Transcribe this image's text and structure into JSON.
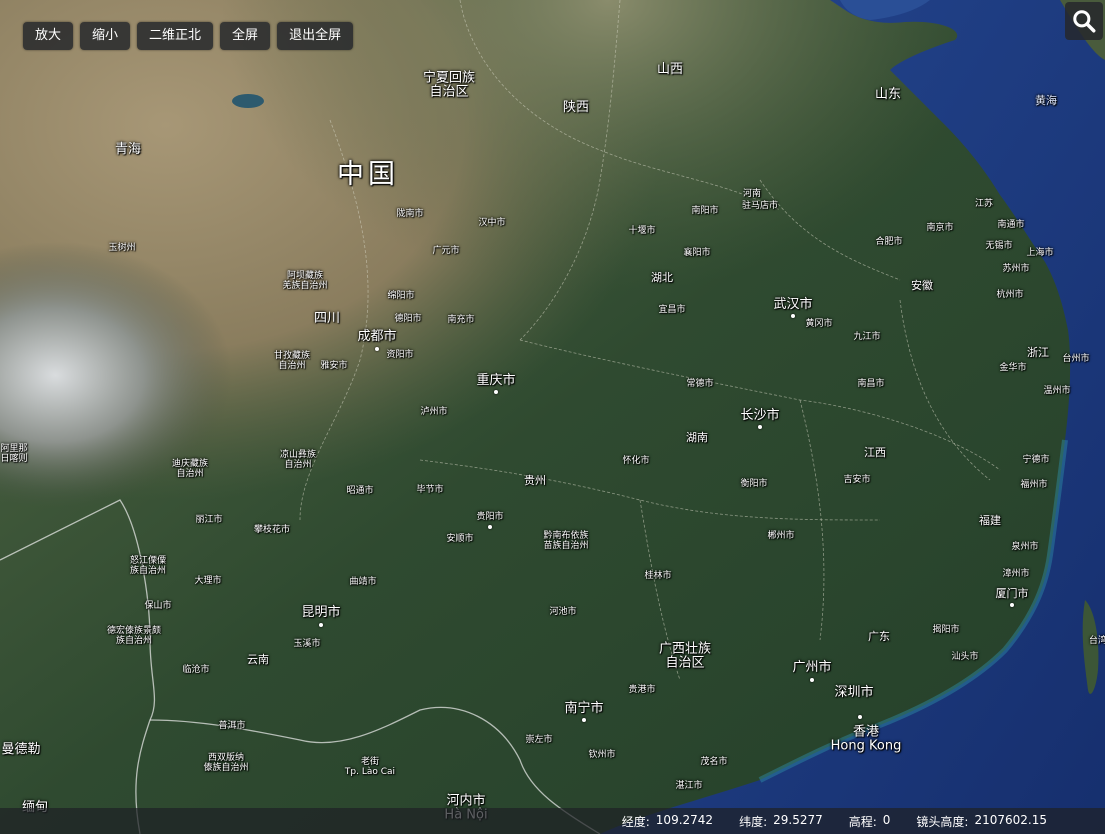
{
  "toolbar": {
    "zoom_in": "放大",
    "zoom_out": "缩小",
    "north_2d": "二维正北",
    "fullscreen": "全屏",
    "exit_fullscreen": "退出全屏"
  },
  "search": {
    "icon": "search-icon"
  },
  "map": {
    "style": "satellite-imagery",
    "colors": {
      "sea": "#1f3f86",
      "land_green": "#2e4a2f",
      "plateau": "#8f7f5e",
      "snow": "#e8ecef"
    },
    "labels": {
      "china": "中国",
      "qinghai": "青海",
      "ningxia": "宁夏回族\n自治区",
      "shaanxi": "陕西",
      "shanxi": "山西",
      "shandong": "山东",
      "yellow_sea": "黄海",
      "henan": "河南",
      "zhumadian": "驻马店市",
      "nanyang": "南阳市",
      "longnan": "陇南市",
      "hanzhong": "汉中市",
      "shiyan": "十堰市",
      "xiangyang": "襄阳市",
      "guangyuan": "广元市",
      "jiangsu": "江苏",
      "nanjing": "南京市",
      "nantong": "南通市",
      "hefei": "合肥市",
      "wuxi": "无锡市",
      "shanghai": "上海市",
      "suzhou": "苏州市",
      "yushu": "玉树州",
      "aba": "阿坝藏族\n羌族自治州",
      "mianyang": "绵阳市",
      "deyang": "德阳市",
      "nanchong": "南充市",
      "sichuan": "四川",
      "chengdu": "成都市",
      "ziyang": "资阳市",
      "hubei": "湖北",
      "yichang": "宜昌市",
      "wuhan": "武汉市",
      "huanggang": "黄冈市",
      "anhui": "安徽",
      "hangzhou": "杭州市",
      "jiujiang": "九江市",
      "ganzi": "甘孜藏族\n自治州",
      "yaan": "雅安市",
      "chongqing": "重庆市",
      "changde": "常德市",
      "zhejiang": "浙江",
      "jinhua": "金华市",
      "taizhou": "台州市",
      "wenzhou": "温州市",
      "nanchang": "南昌市",
      "luzhou": "泸州市",
      "changsha": "长沙市",
      "hunan": "湖南",
      "nagqu": "阿里那\n日喀则",
      "liangshan": "凉山彝族\n自治州",
      "diqing": "迪庆藏族\n自治州",
      "zhaotong": "昭通市",
      "bijie": "毕节市",
      "guizhou": "贵州",
      "huaihua": "怀化市",
      "jiangxi": "江西",
      "hengyang": "衡阳市",
      "jian": "吉安市",
      "ningde": "宁德市",
      "fuzhou": "福州市",
      "lijiang": "丽江市",
      "panzhihua": "攀枝花市",
      "guiyang": "贵阳市",
      "anshun": "安顺市",
      "qiannan": "黔南布依族\n苗族自治州",
      "chenzhou": "郴州市",
      "fujian": "福建",
      "quanzhou": "泉州市",
      "nujiang": "怒江傈僳\n族自治州",
      "dali": "大理市",
      "qujing": "曲靖市",
      "guilin": "桂林市",
      "zhangzhou": "漳州市",
      "xiamen": "厦门市",
      "baoshan": "保山市",
      "dehong": "德宏傣族景颇\n族自治州",
      "kunming": "昆明市",
      "yuxi": "玉溪市",
      "hechi": "河池市",
      "guangdong": "广东",
      "jieyang": "揭阳市",
      "shantou": "汕头市",
      "lincang": "临沧市",
      "yunnan": "云南",
      "guangxi": "广西壮族\n自治区",
      "guangzhou": "广州市",
      "shenzhen": "深圳市",
      "nanning": "南宁市",
      "guigang": "贵港市",
      "puer": "普洱市",
      "xishuangbanna": "西双版纳\n傣族自治州",
      "laocai": "老街\nTp. Lào Cai",
      "chongzuo": "崇左市",
      "qinzhou": "钦州市",
      "maoming": "茂名市",
      "hongkong": "香港\nHong Kong",
      "zhanjiang": "湛江市",
      "hanoi": "河内市\nHà Nội",
      "mandalay": "曼德勒",
      "myanmar": "缅甸",
      "taiwan": "台湾"
    }
  },
  "status": {
    "lon_label": "经度:",
    "lon_value": "109.2742",
    "lat_label": "纬度:",
    "lat_value": "29.5277",
    "elev_label": "高程:",
    "elev_value": "0",
    "cam_label": "镜头高度:",
    "cam_value": "2107602.15"
  }
}
